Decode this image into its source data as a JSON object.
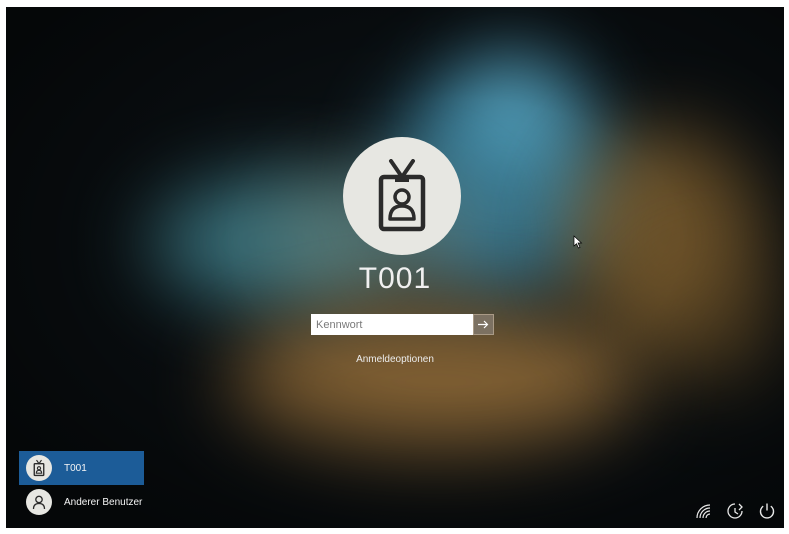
{
  "login": {
    "username": "T001",
    "password_placeholder": "Kennwort",
    "submit_icon": "arrow-right-icon",
    "sign_in_options_label": "Anmeldeoptionen"
  },
  "user_list": {
    "items": [
      {
        "label": "T001",
        "icon": "id-badge-icon",
        "selected": true
      },
      {
        "label": "Anderer Benutzer",
        "icon": "person-icon",
        "selected": false
      }
    ]
  },
  "system_icons": [
    "network-icon",
    "ease-of-access-icon",
    "power-icon"
  ],
  "colors": {
    "selected_user_bg": "#1c5c98",
    "avatar_bg": "#e7e7e2",
    "submit_button_bg": "#7c7162"
  }
}
